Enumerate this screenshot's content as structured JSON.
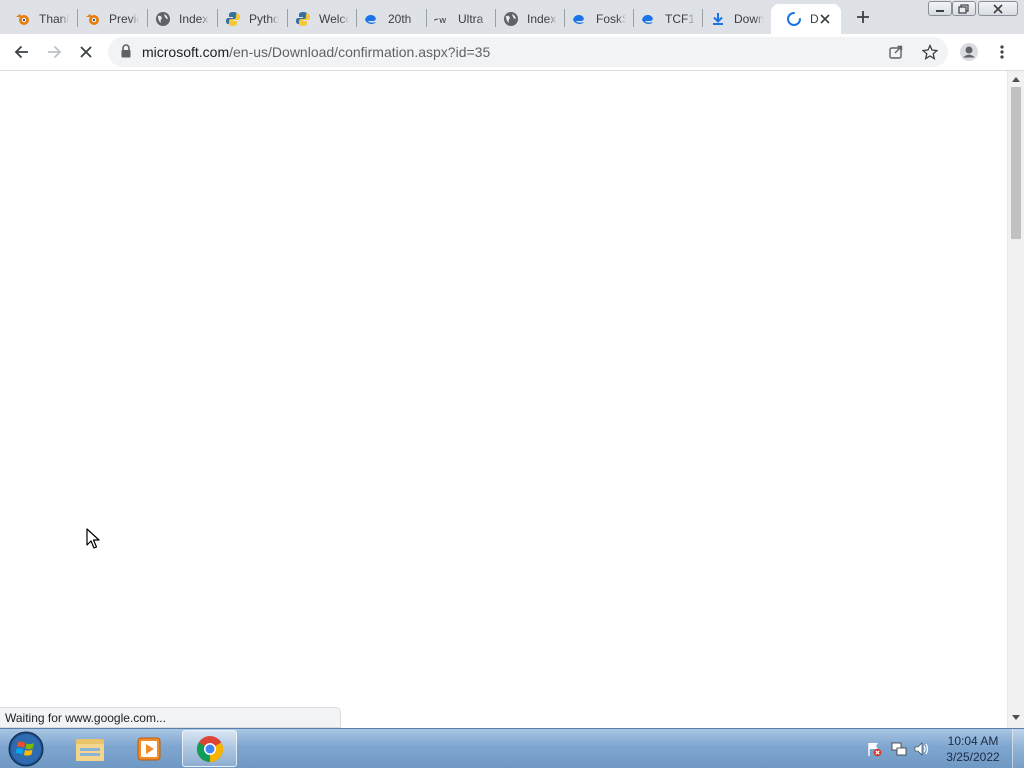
{
  "tabs": [
    {
      "label": "Thank",
      "icon": "blender-icon"
    },
    {
      "label": "Previe",
      "icon": "blender-icon"
    },
    {
      "label": "Index",
      "icon": "globe-icon"
    },
    {
      "label": "Pytho",
      "icon": "python-icon"
    },
    {
      "label": "Welco",
      "icon": "python-icon"
    },
    {
      "label": "20th",
      "icon": "edge-icon"
    },
    {
      "label": "Ultra",
      "icon": "w-icon"
    },
    {
      "label": "Index",
      "icon": "globe-icon"
    },
    {
      "label": "FoskS",
      "icon": "edge-icon"
    },
    {
      "label": "TCF1",
      "icon": "edge-icon"
    },
    {
      "label": "Down",
      "icon": "download-icon"
    },
    {
      "label": "D",
      "icon": "loading-spinner-icon",
      "active": true
    }
  ],
  "toolbar": {
    "url_host": "microsoft.com",
    "url_path": "/en-us/Download/confirmation.aspx?id=35"
  },
  "status": {
    "text": "Waiting for www.google.com..."
  },
  "taskbar": {
    "time": "10:04 AM",
    "date": "3/25/2022"
  },
  "colors": {
    "tabstrip_bg": "#dee1e6",
    "omnibox_bg": "#f1f3f4",
    "taskbar_accent": "#7ea6cf",
    "edge_blue": "#1a73e8"
  }
}
